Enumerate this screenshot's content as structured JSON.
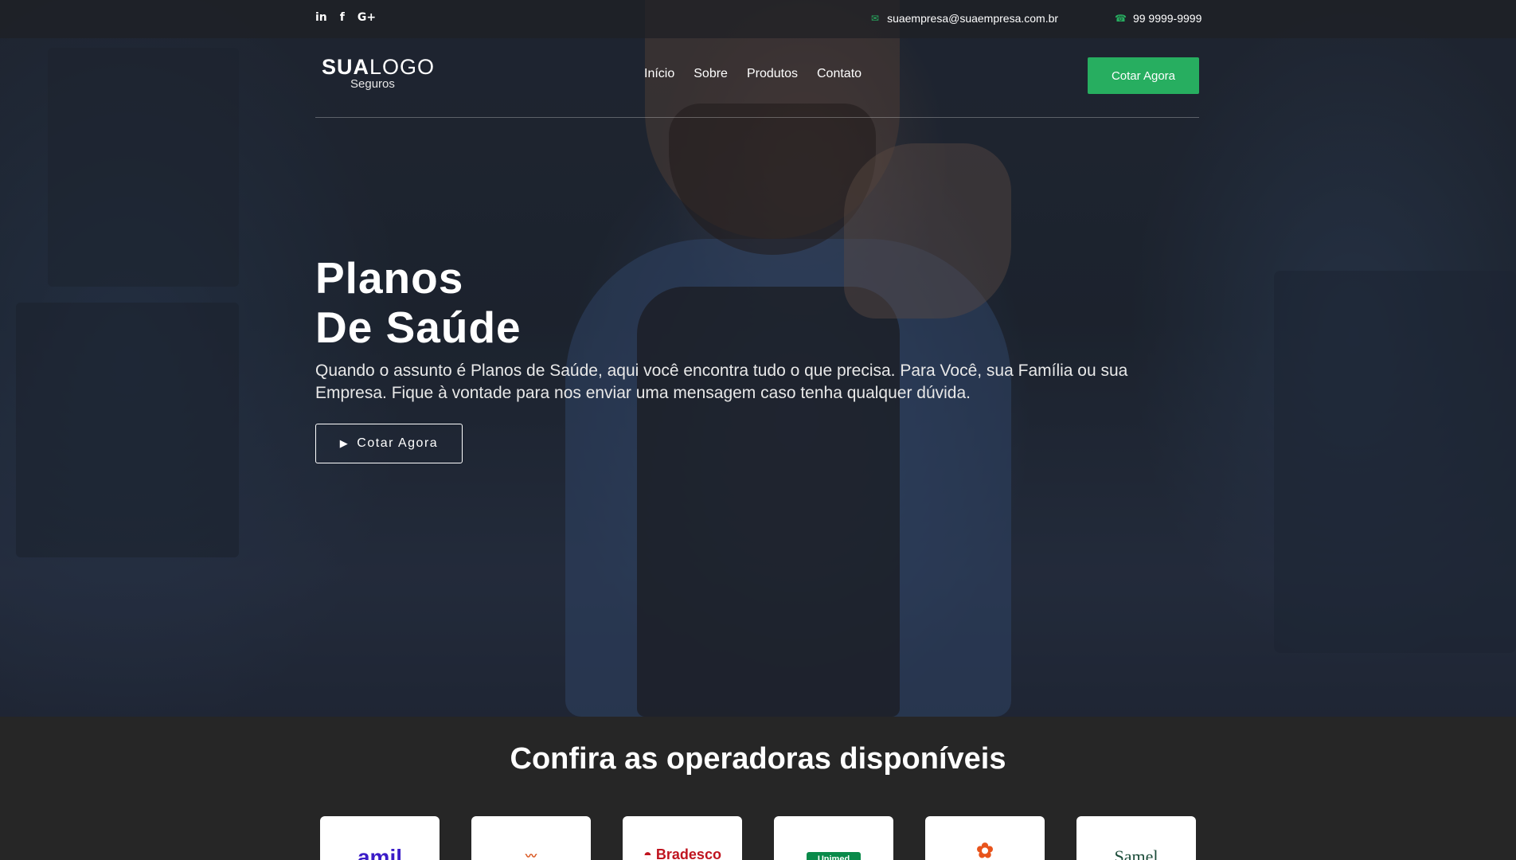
{
  "topbar": {
    "social": [
      {
        "name": "linkedin",
        "glyph": "in"
      },
      {
        "name": "facebook",
        "glyph": "f"
      },
      {
        "name": "google-plus",
        "glyph": "G+"
      }
    ],
    "email": "suaempresa@suaempresa.com.br",
    "phone": "99 9999-9999",
    "icons": {
      "email": "envelope-icon",
      "phone": "phone-icon"
    }
  },
  "logo": {
    "main_bold": "SUA",
    "main_light": "LOGO",
    "sub": "Seguros"
  },
  "nav": {
    "items": [
      "Início",
      "Sobre",
      "Produtos",
      "Contato"
    ],
    "cta": "Cotar Agora"
  },
  "hero": {
    "title_line1": "Planos",
    "title_line2": "De Saúde",
    "description": "Quando o assunto é Planos de Saúde, aqui você encontra tudo o que precisa. Para Você, sua Família ou sua Empresa. Fique à vontade para nos enviar uma mensagem caso tenha qualquer dúvida.",
    "button": "Cotar Agora",
    "button_icon": "play-icon"
  },
  "operators": {
    "title": "Confira as operadoras disponíveis",
    "cards": [
      {
        "name": "amil",
        "label": "amil"
      },
      {
        "name": "sulamerica",
        "label": ""
      },
      {
        "name": "bradesco",
        "label": "Bradesco"
      },
      {
        "name": "unimed",
        "label": "Unimed"
      },
      {
        "name": "flower-logo",
        "label": ""
      },
      {
        "name": "samel",
        "label": "Samel"
      }
    ]
  },
  "colors": {
    "accent": "#27ae60",
    "dark_bg": "#262626"
  }
}
